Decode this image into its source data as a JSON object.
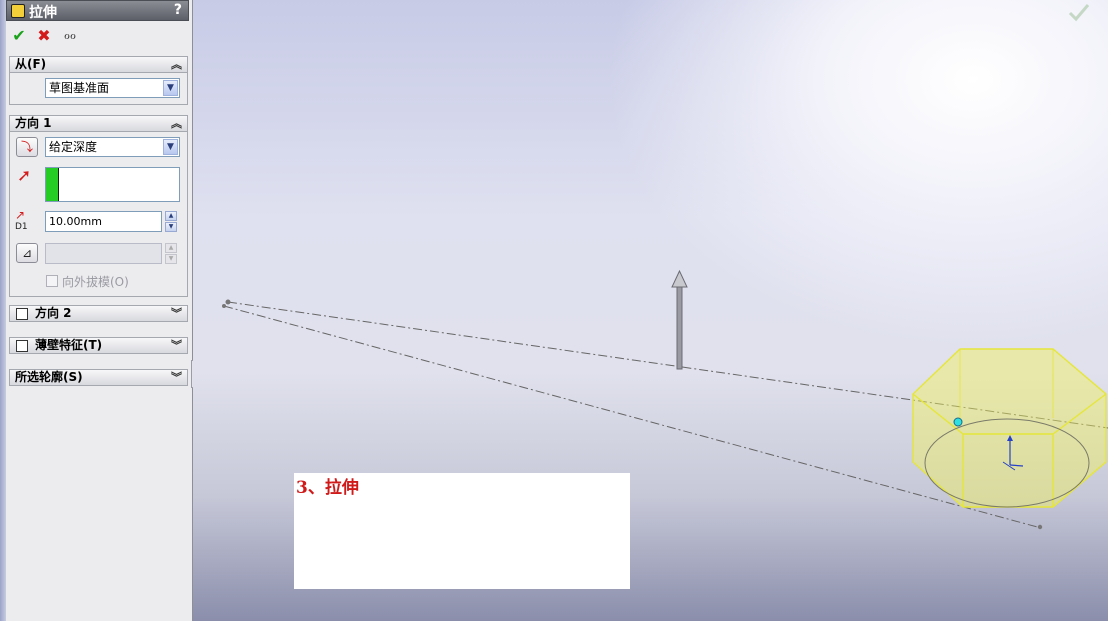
{
  "panel": {
    "title": "拉伸",
    "help": "?",
    "toolbar": {
      "ok": "✔",
      "cancel": "✖",
      "preview": "ℴℴ"
    },
    "from": {
      "header": "从(F)",
      "select_value": "草图基准面"
    },
    "direction1": {
      "header": "方向 1",
      "end_condition": "给定深度",
      "depth": "10.00mm",
      "depth_icon_label": "D1",
      "draft_outward": "向外拔模(O)"
    },
    "direction2": {
      "header": "方向 2"
    },
    "thin_feature": {
      "header": "薄壁特征(T)"
    },
    "selected_contours": {
      "header": "所选轮廓(S)"
    }
  },
  "caption": {
    "text": "3、拉伸"
  },
  "colors": {
    "accent_red": "#d01a1a",
    "preview_yellow": "#f2f25a",
    "ok_green": "#1aa31a"
  }
}
